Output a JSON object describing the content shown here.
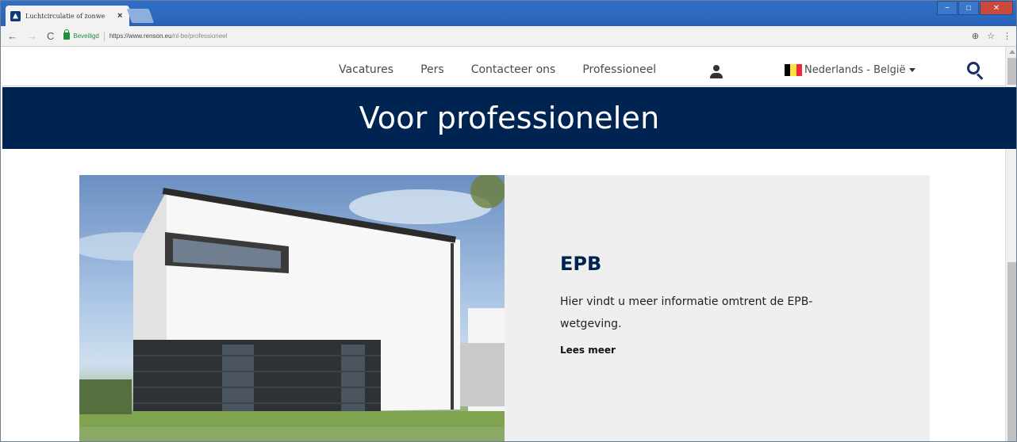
{
  "browser": {
    "tab_title": "Luchtcirculatie of zonwe",
    "tab_close": "×",
    "secure_label": "Beveiligd",
    "url_base": "https://www.renson.eu",
    "url_path": "/nl-be/professioneel",
    "nav_back": "←",
    "nav_forward": "→",
    "nav_reload": "C",
    "zoom_icon": "⊕",
    "star_icon": "☆",
    "menu_icon": "⋮",
    "window_minimize": "−",
    "window_maximize": "□",
    "window_close": "✕"
  },
  "header": {
    "nav": [
      "Vacatures",
      "Pers",
      "Contacteer ons",
      "Professioneel"
    ],
    "language": "Nederlands - België",
    "flag_colors": [
      "#000000",
      "#FAE042",
      "#ED2939"
    ]
  },
  "hero": {
    "title": "Voor professionelen"
  },
  "card": {
    "title": "EPB",
    "description": "Hier vindt u meer informatie omtrent de EPB-wetgeving.",
    "link": "Lees meer"
  },
  "colors": {
    "brand_navy": "#002452",
    "card_bg": "#efefef"
  }
}
